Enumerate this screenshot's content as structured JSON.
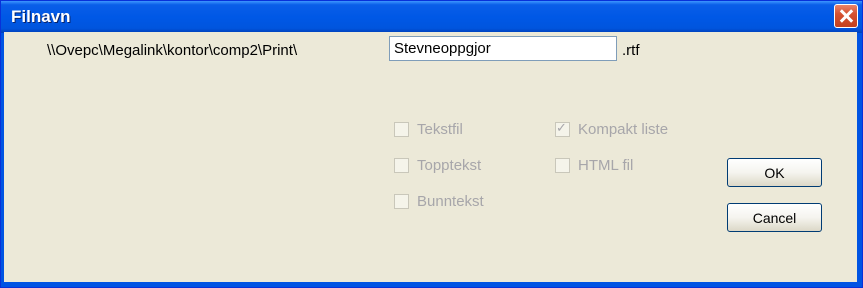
{
  "dialog": {
    "title": "Filnavn",
    "path_prefix": "\\\\Ovepc\\Megalink\\kontor\\comp2\\Print\\",
    "filename_value": "Stevneoppgjor",
    "extension": ".rtf"
  },
  "options": {
    "tekstfil": {
      "label": "Tekstfil",
      "checked": false
    },
    "topptekst": {
      "label": "Topptekst",
      "checked": false
    },
    "bunntekst": {
      "label": "Bunntekst",
      "checked": false
    },
    "kompakt": {
      "label": "Kompakt liste",
      "checked": true
    },
    "html": {
      "label": "HTML fil",
      "checked": false
    }
  },
  "buttons": {
    "ok": "OK",
    "cancel": "Cancel"
  }
}
